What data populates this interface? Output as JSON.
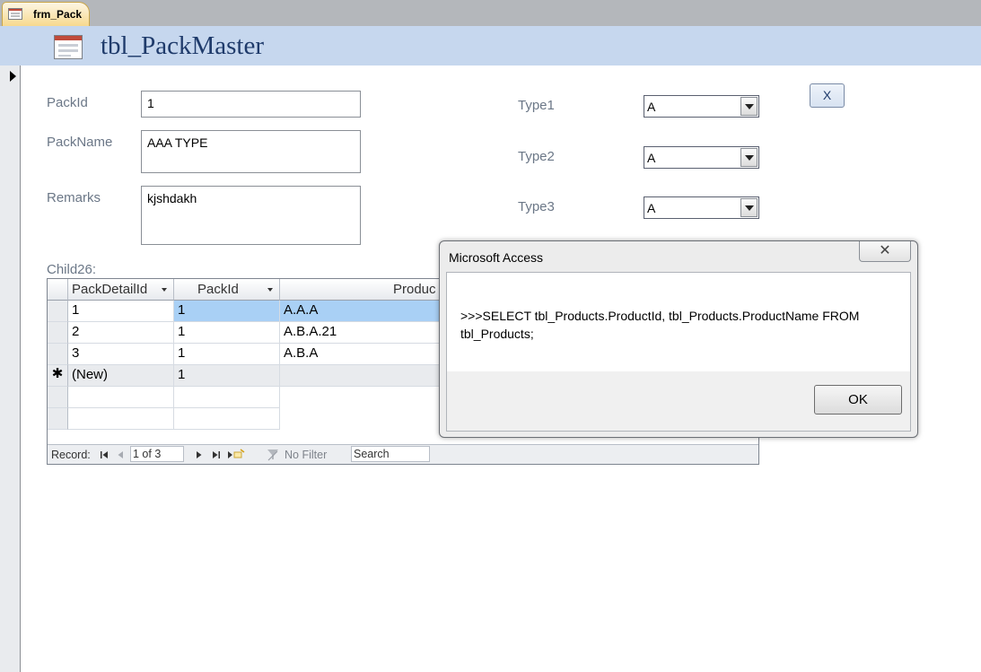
{
  "tab": {
    "label": "frm_Pack"
  },
  "header": {
    "title": "tbl_PackMaster"
  },
  "form": {
    "fields": {
      "pack_id": {
        "label": "PackId",
        "value": "1"
      },
      "pack_name": {
        "label": "PackName",
        "value": "AAA TYPE"
      },
      "remarks": {
        "label": "Remarks",
        "value": "kjshdakh"
      },
      "type1": {
        "label": "Type1",
        "value": "A"
      },
      "type2": {
        "label": "Type2",
        "value": "A"
      },
      "type3": {
        "label": "Type3",
        "value": "A"
      }
    },
    "close_button": "X"
  },
  "subform": {
    "label": "Child26:",
    "columns": [
      "PackDetailId",
      "PackId",
      "Produc"
    ],
    "rows": [
      {
        "id": "1",
        "pack": "1",
        "product": "A.A.A"
      },
      {
        "id": "2",
        "pack": "1",
        "product": "A.B.A.21"
      },
      {
        "id": "3",
        "pack": "1",
        "product": "A.B.A"
      }
    ],
    "new_row": {
      "id": "(New)",
      "pack": "1",
      "marker": "✱"
    },
    "nav": {
      "record_label": "Record:",
      "position": "1 of 3",
      "filter_label": "No Filter",
      "search_placeholder": "Search"
    }
  },
  "dialog": {
    "title": "Microsoft Access",
    "close_glyph": "✕",
    "message": ">>>SELECT tbl_Products.ProductId, tbl_Products.ProductName FROM tbl_Products;",
    "ok_label": "OK"
  }
}
